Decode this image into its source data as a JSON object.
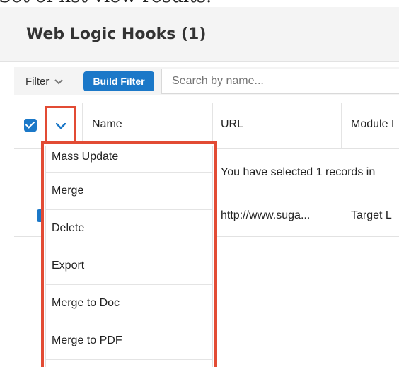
{
  "caption": "Set of list view results.",
  "header": {
    "title": "Web Logic Hooks (1)"
  },
  "filterbar": {
    "filter_label": "Filter",
    "build_filter_label": "Build Filter",
    "search_placeholder": "Search by name..."
  },
  "table": {
    "columns": [
      "Name",
      "URL",
      "Module I"
    ],
    "selection_message": "You have selected 1 records in",
    "row": {
      "url": "http://www.suga...",
      "module": "Target L"
    }
  },
  "menu": {
    "items": [
      {
        "label": "Mass Update"
      },
      {
        "label": "Merge"
      },
      {
        "label": "Delete"
      },
      {
        "label": "Export"
      },
      {
        "label": "Merge to Doc"
      },
      {
        "label": "Merge to PDF"
      }
    ]
  },
  "colors": {
    "accent": "#1b78c8",
    "highlight": "#e24b34"
  },
  "icons": {
    "filter_chevron": "chevron-down-icon",
    "checkbox": "check-icon",
    "actions_chevron": "chevron-down-icon"
  }
}
